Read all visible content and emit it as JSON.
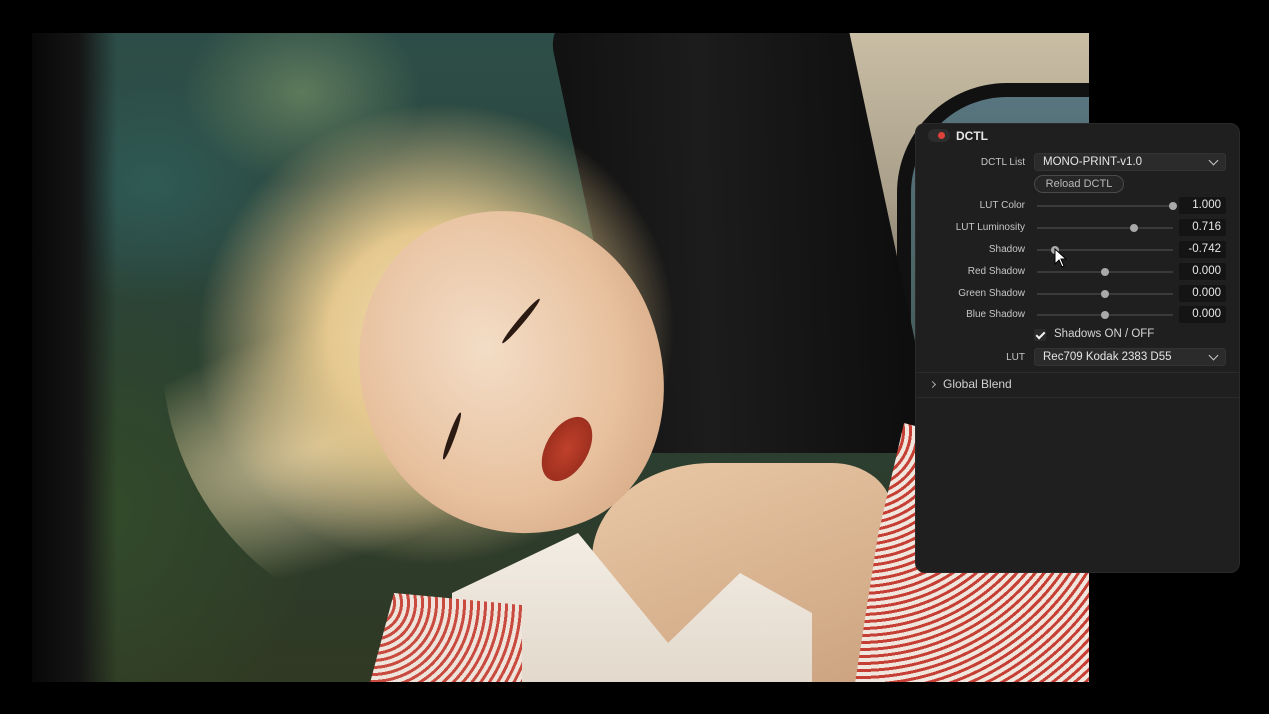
{
  "panel": {
    "title": "DCTL",
    "dctl_list_label": "DCTL List",
    "dctl_list_value": "MONO-PRINT-v1.0",
    "reload_label": "Reload DCTL",
    "sliders": [
      {
        "label": "LUT Color",
        "value": "1.000",
        "position": 1.0
      },
      {
        "label": "LUT Luminosity",
        "value": "0.716",
        "position": 0.716
      },
      {
        "label": "Shadow",
        "value": "-0.742",
        "position": 0.129
      },
      {
        "label": "Red Shadow",
        "value": "0.000",
        "position": 0.5
      },
      {
        "label": "Green Shadow",
        "value": "0.000",
        "position": 0.5
      },
      {
        "label": "Blue Shadow",
        "value": "0.000",
        "position": 0.5
      }
    ],
    "shadows_toggle_label": "Shadows ON / OFF",
    "shadows_toggle_checked": true,
    "lut_label": "LUT",
    "lut_value": "Rec709 Kodak 2383 D55",
    "global_blend_label": "Global Blend"
  },
  "colors": {
    "panel_bg": "#1f1f20",
    "status_dot": "#e0413a"
  }
}
